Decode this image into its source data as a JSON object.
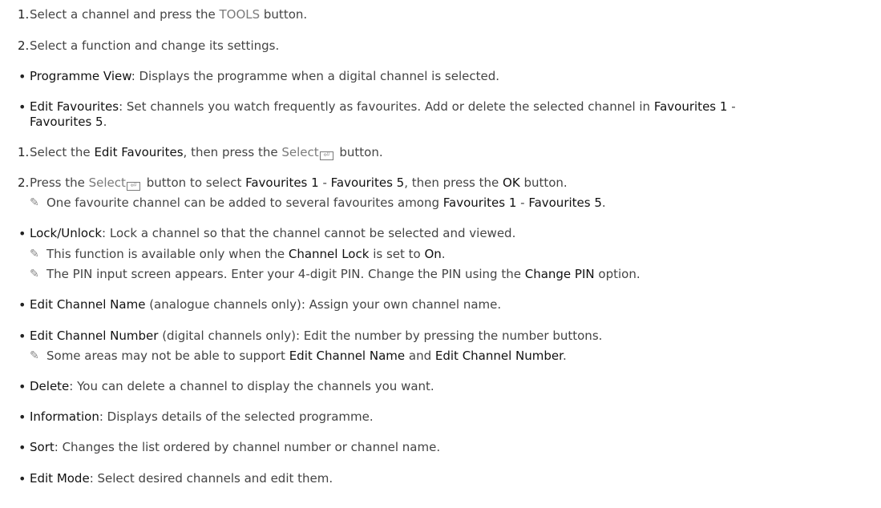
{
  "s1": {
    "num": "1.",
    "pre": "Select a channel and press the ",
    "tools": "TOOLS",
    "post": " button."
  },
  "s2": {
    "num": "2.",
    "text": "Select a function and change its settings."
  },
  "b1": {
    "bullet": "•",
    "term": "Programme View",
    "rest": ": Displays the programme when a digital channel is selected."
  },
  "b2": {
    "bullet": "•",
    "term": "Edit Favourites",
    "rest": ": Set channels you watch frequently as favourites. Add or delete the selected channel in ",
    "fav1": "Favourites 1",
    "dash": " -",
    "fav5": "Favourites 5",
    "end": "."
  },
  "f1": {
    "num": "1.",
    "pre": "Select the ",
    "term": "Edit Favourites",
    "mid": ", then press the ",
    "select": "Select",
    "post": " button."
  },
  "f2": {
    "num": "2.",
    "pre": "Press the ",
    "select": "Select",
    "mid": " button to select ",
    "fav1": "Favourites 1",
    "dash": " - ",
    "fav5": "Favourites 5",
    "mid2": ", then press the ",
    "ok": "OK",
    "post": " button."
  },
  "n1": {
    "pre": "One favourite channel can be added to several favourites among ",
    "fav1": "Favourites 1",
    "dash": " - ",
    "fav5": "Favourites 5",
    "end": "."
  },
  "b3": {
    "bullet": "•",
    "term": "Lock/Unlock",
    "rest": ": Lock a channel so that the channel cannot be selected and viewed."
  },
  "n2": {
    "pre": "This function is available only when the ",
    "term": "Channel Lock",
    "mid": " is set to ",
    "on": "On",
    "end": "."
  },
  "n3": {
    "pre": "The PIN input screen appears. Enter your 4-digit PIN. Change the PIN using the ",
    "term": "Change PIN",
    "end": " option."
  },
  "b4": {
    "bullet": "•",
    "term": "Edit Channel Name",
    "rest": " (analogue channels only): Assign your own channel name."
  },
  "b5": {
    "bullet": "•",
    "term": "Edit Channel Number",
    "rest": " (digital channels only): Edit the number by pressing the number buttons."
  },
  "n4": {
    "pre": "Some areas may not be able to support ",
    "term1": "Edit Channel Name",
    "mid": " and ",
    "term2": "Edit Channel Number",
    "end": "."
  },
  "b6": {
    "bullet": "•",
    "term": "Delete",
    "rest": ": You can delete a channel to display the channels you want."
  },
  "b7": {
    "bullet": "•",
    "term": "Information",
    "rest": ": Displays details of the selected programme."
  },
  "b8": {
    "bullet": "•",
    "term": "Sort",
    "rest": ": Changes the list ordered by channel number or channel name."
  },
  "b9": {
    "bullet": "•",
    "term": "Edit Mode",
    "rest": ": Select desired channels and edit them."
  },
  "icons": {
    "note": "pencil-icon",
    "enter": "enter-key-icon"
  },
  "colors": {
    "text": "#444444",
    "term": "#111111",
    "key": "#7a7a7a"
  }
}
